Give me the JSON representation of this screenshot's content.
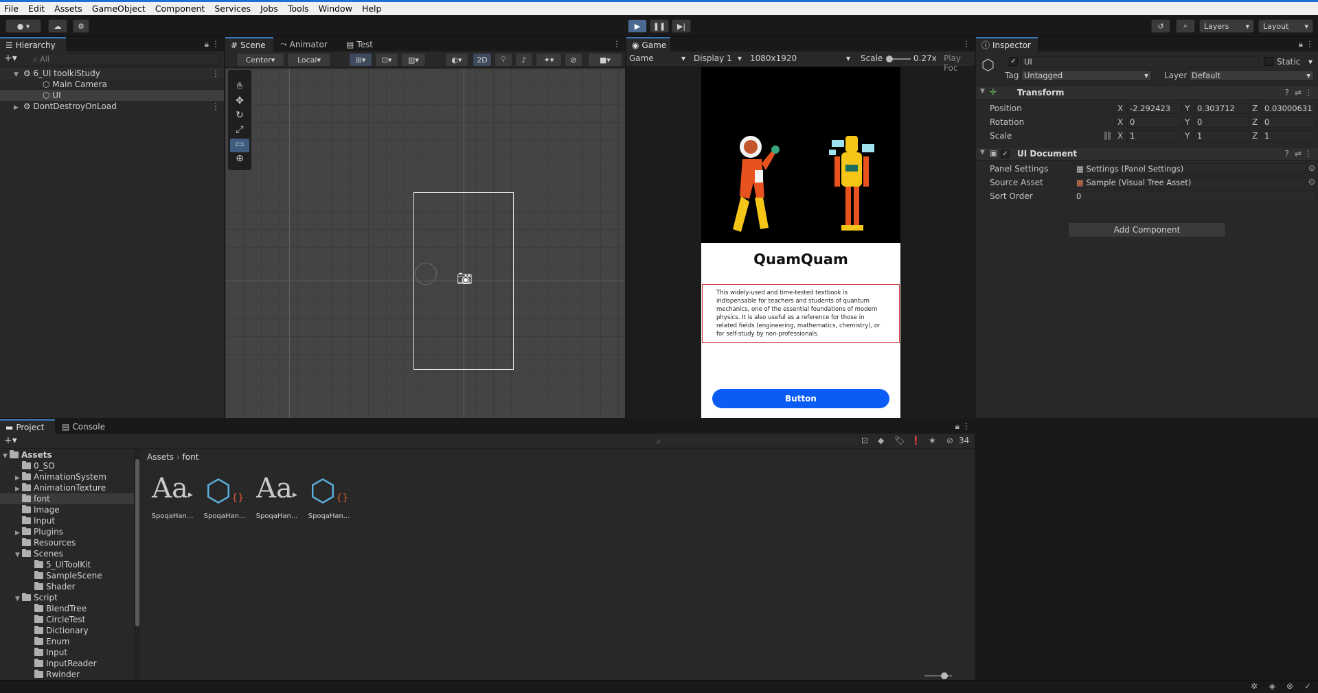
{
  "menu": [
    "File",
    "Edit",
    "Assets",
    "GameObject",
    "Component",
    "Services",
    "Jobs",
    "Tools",
    "Window",
    "Help"
  ],
  "toolbar": {
    "layers_label": "Layers",
    "layout_label": "Layout"
  },
  "hierarchy": {
    "tab": "Hierarchy",
    "search_placeholder": "All",
    "items": [
      {
        "label": "6_UI toolkiStudy"
      },
      {
        "label": "Main Camera"
      },
      {
        "label": "UI"
      },
      {
        "label": "DontDestroyOnLoad"
      }
    ]
  },
  "scene": {
    "tabs": [
      "Scene",
      "Animator",
      "Test"
    ],
    "pivot": "Center",
    "space": "Local",
    "mode_2d": "2D"
  },
  "game": {
    "tab": "Game",
    "view": "Game",
    "display": "Display 1",
    "resolution": "1080x1920",
    "scale_label": "Scale",
    "scale_value": "0.27x",
    "play_focus": "Play Foc",
    "title": "QuamQuam",
    "description": "This widely-used and time-tested textbook is indispensable for teachers and students of quantum mechanics, one of the essential foundations of modern physics. It is also useful as a reference for those in related fields (engineering, mathematics, chemistry), or for self-study by non-professionals.",
    "button": "Button"
  },
  "inspector": {
    "tab": "Inspector",
    "object_name": "UI",
    "static_label": "Static",
    "tag_label": "Tag",
    "tag_value": "Untagged",
    "layer_label": "Layer",
    "layer_value": "Default",
    "transform": {
      "title": "Transform",
      "position_label": "Position",
      "rotation_label": "Rotation",
      "scale_label": "Scale",
      "position": {
        "x": "-2.292423",
        "y": "0.303712",
        "z": "0.03000631"
      },
      "rotation": {
        "x": "0",
        "y": "0",
        "z": "0"
      },
      "scale": {
        "x": "1",
        "y": "1",
        "z": "1"
      }
    },
    "ui_document": {
      "title": "UI Document",
      "panel_settings_label": "Panel Settings",
      "panel_settings_value": "Settings (Panel Settings)",
      "source_asset_label": "Source Asset",
      "source_asset_value": "Sample (Visual Tree Asset)",
      "sort_order_label": "Sort Order",
      "sort_order_value": "0"
    },
    "add_component": "Add Component"
  },
  "project": {
    "tabs": [
      "Project",
      "Console"
    ],
    "hidden_count": "34",
    "breadcrumb": [
      "Assets",
      "font"
    ],
    "tree": [
      {
        "label": "Assets",
        "depth": 0,
        "arrow": "▼"
      },
      {
        "label": "0_SO",
        "depth": 1,
        "arrow": ""
      },
      {
        "label": "AnimationSystem",
        "depth": 1,
        "arrow": "▶"
      },
      {
        "label": "AnimationTexture",
        "depth": 1,
        "arrow": "▶"
      },
      {
        "label": "font",
        "depth": 1,
        "arrow": ""
      },
      {
        "label": "Image",
        "depth": 1,
        "arrow": ""
      },
      {
        "label": "Input",
        "depth": 1,
        "arrow": ""
      },
      {
        "label": "Plugins",
        "depth": 1,
        "arrow": "▶"
      },
      {
        "label": "Resources",
        "depth": 1,
        "arrow": ""
      },
      {
        "label": "Scenes",
        "depth": 1,
        "arrow": "▼"
      },
      {
        "label": "5_UIToolKit",
        "depth": 2,
        "arrow": ""
      },
      {
        "label": "SampleScene",
        "depth": 2,
        "arrow": ""
      },
      {
        "label": "Shader",
        "depth": 2,
        "arrow": ""
      },
      {
        "label": "Script",
        "depth": 1,
        "arrow": "▼"
      },
      {
        "label": "BlendTree",
        "depth": 2,
        "arrow": ""
      },
      {
        "label": "CircleTest",
        "depth": 2,
        "arrow": ""
      },
      {
        "label": "Dictionary",
        "depth": 2,
        "arrow": ""
      },
      {
        "label": "Enum",
        "depth": 2,
        "arrow": ""
      },
      {
        "label": "Input",
        "depth": 2,
        "arrow": ""
      },
      {
        "label": "InputReader",
        "depth": 2,
        "arrow": ""
      },
      {
        "label": "Rwinder",
        "depth": 2,
        "arrow": ""
      }
    ],
    "assets": [
      {
        "label": "SpoqaHan...",
        "icon": "font-icon"
      },
      {
        "label": "SpoqaHan...",
        "icon": "font-asset-icon"
      },
      {
        "label": "SpoqaHan...",
        "icon": "font-icon"
      },
      {
        "label": "SpoqaHan...",
        "icon": "font-asset-icon"
      }
    ]
  },
  "colors": {
    "accent": "#3a79bb",
    "game_button": "#0a5cf5",
    "selection_border": "#d0302f",
    "robot": "#f5c518",
    "astronaut": "#e8521e"
  }
}
